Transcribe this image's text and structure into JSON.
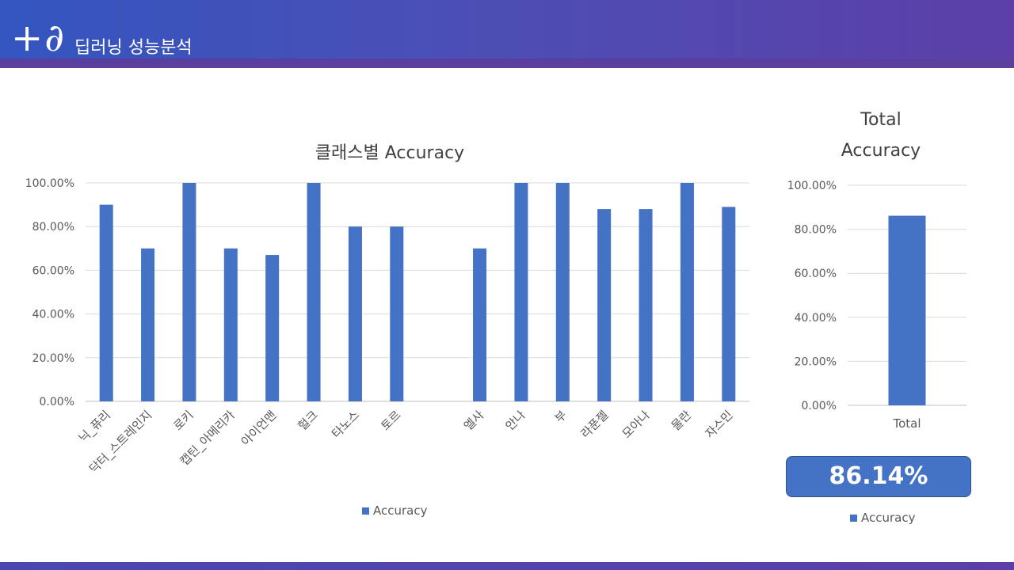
{
  "header": {
    "logo": "+∂",
    "title": "딥러닝 성능분석"
  },
  "colors": {
    "bar": "#4472c4",
    "grid": "#d9d9d9",
    "header_start": "#3355bf",
    "header_end": "#5c3fa8"
  },
  "total_value_text": "86.14%",
  "chart_data": [
    {
      "type": "bar",
      "title": "클래스별 Accuracy",
      "categories": [
        "닉_퓨리",
        "닥터_스트레인지",
        "로키",
        "캡틴_아메리카",
        "아이언맨",
        "헐크",
        "타노스",
        "토르",
        "",
        "엘사",
        "안나",
        "부",
        "라푼젤",
        "모아나",
        "물란",
        "자스민"
      ],
      "series": [
        {
          "name": "Accuracy",
          "values": [
            0.9,
            0.7,
            1.0,
            0.7,
            0.67,
            1.0,
            0.8,
            0.8,
            null,
            0.7,
            1.0,
            1.0,
            0.88,
            0.88,
            1.0,
            0.89
          ]
        }
      ],
      "ylim": [
        0,
        1
      ],
      "yticks": [
        "0.00%",
        "20.00%",
        "40.00%",
        "60.00%",
        "80.00%",
        "100.00%"
      ],
      "grid": true,
      "legend": "bottom"
    },
    {
      "type": "bar",
      "title": "Total Accuracy",
      "title_lines": [
        "Total",
        "Accuracy"
      ],
      "categories": [
        "Total"
      ],
      "series": [
        {
          "name": "Accuracy",
          "values": [
            0.8614
          ]
        }
      ],
      "ylim": [
        0,
        1
      ],
      "yticks": [
        "0.00%",
        "20.00%",
        "40.00%",
        "60.00%",
        "80.00%",
        "100.00%"
      ],
      "grid": true,
      "legend": "bottom"
    }
  ]
}
